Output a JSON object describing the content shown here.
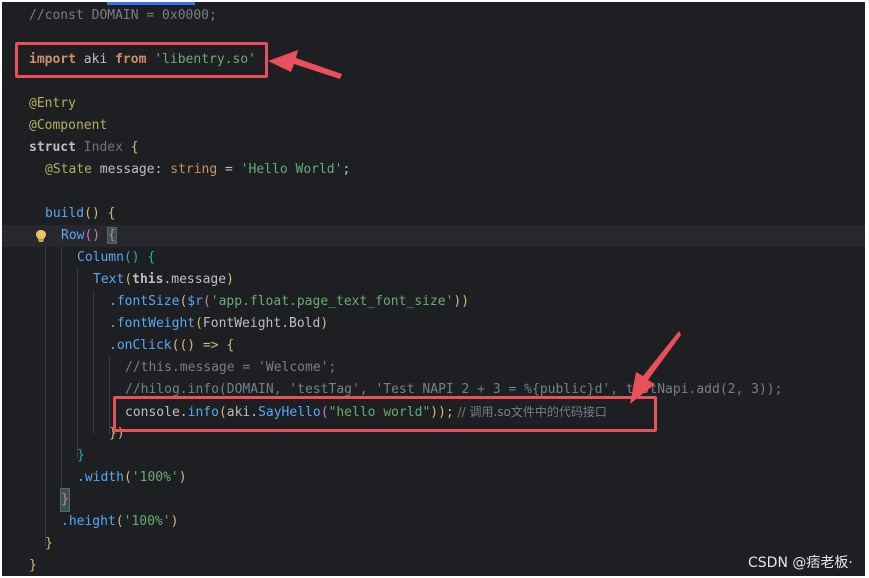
{
  "code": {
    "l1": "//const DOMAIN = 0x0000;",
    "l2_import": "import",
    "l2_name": " aki ",
    "l2_from": "from",
    "l2_space": " ",
    "l2_str": "'libentry.so'",
    "l3_entry": "@Entry",
    "l4_comp": "@Component",
    "l5_struct": "struct",
    "l5_cls": " Index ",
    "l5_brace": "{",
    "l6_state": "@State",
    "l6_rest1": " message: ",
    "l6_type": "string",
    "l6_eq": " = ",
    "l6_str": "'Hello World'",
    "l6_semi": ";",
    "l7_build": "build",
    "l7_rest": "() {",
    "l8_row": "Row",
    "l8_paren": "()",
    "l8_sp": " ",
    "l8_brace": "{",
    "l9_col": "Column",
    "l9_rest": "() {",
    "l10_text": "Text",
    "l10_open": "(",
    "l10_this": "this",
    "l10_msg": ".message",
    "l10_close": ")",
    "l11_fs": ".fontSize",
    "l11_open": "(",
    "l11_r": "$r",
    "l11_open2": "(",
    "l11_str": "'app.float.page_text_font_size'",
    "l11_close": "))",
    "l12_fw": ".fontWeight",
    "l12_open": "(",
    "l12_arg": "FontWeight.Bold",
    "l12_close": ")",
    "l13_oc": ".onClick",
    "l13_rest": "(() => {",
    "l14_cmt": "//this.message = 'Welcome';",
    "l15_cmt": "//hilog.info(DOMAIN, 'testTag', 'Test NAPI 2 + 3 = %{public}d', testNapi.add(2, 3));",
    "l16_console": "console",
    "l16_dot": ".",
    "l16_info": "info",
    "l16_open": "(",
    "l16_aki": "aki.",
    "l16_say": "SayHello",
    "l16_open2": "(",
    "l16_str": "\"hello world\"",
    "l16_close": "));",
    "l16_cmt": " // 调用.so文件中的代码接口",
    "l17": "})",
    "l18": "}",
    "l19_w": ".width",
    "l19_open": "(",
    "l19_str": "'100%'",
    "l19_close": ")",
    "l20": "}",
    "l21_h": ".height",
    "l21_open": "(",
    "l21_str": "'100%'",
    "l21_close": ")",
    "l22": "}",
    "l23": "}"
  },
  "watermark": "CSDN @痞老板·",
  "colors": {
    "editor_bg": "#1e1f22",
    "annotation_red": "#e8515c",
    "keyword": "#cf8e6d",
    "string": "#6aab73",
    "function": "#56a8f5",
    "comment": "#7a7e85",
    "decorator": "#b3ae60"
  },
  "icons": {
    "intention": "lightbulb-icon"
  }
}
